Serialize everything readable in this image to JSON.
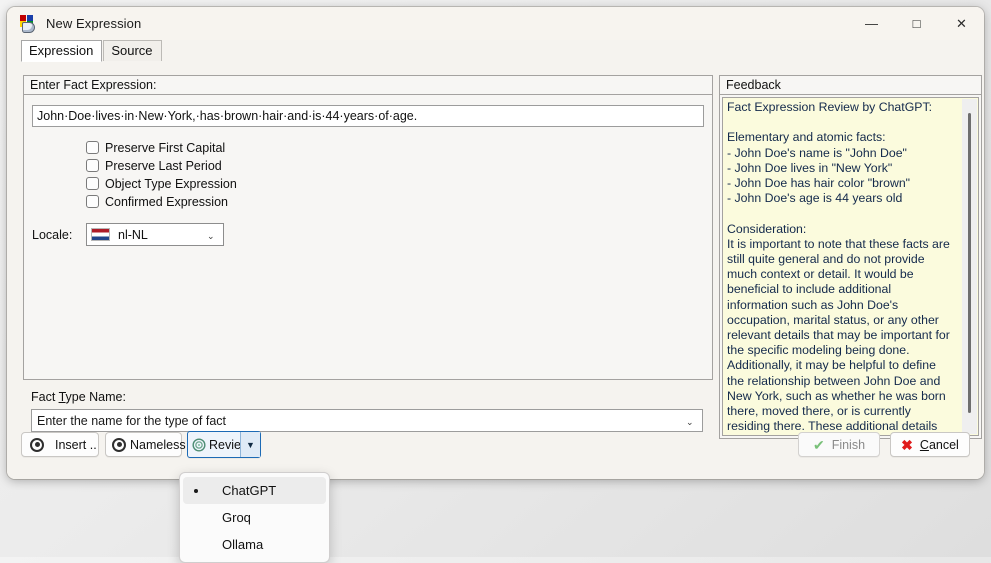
{
  "window": {
    "title": "New Expression",
    "icon": "app-cube-icon",
    "controls": {
      "minimize": "—",
      "maximize": "□",
      "close": "✕"
    }
  },
  "tabs": [
    {
      "label": "Expression",
      "active": true
    },
    {
      "label": "Source",
      "active": false
    }
  ],
  "expression_group": {
    "title": "Enter Fact Expression:",
    "input_value": "John·Doe·lives·in·New·York,·has·brown·hair·and·is·44·years·of·age.",
    "checkboxes": [
      {
        "label": "Preserve First Capital",
        "checked": false
      },
      {
        "label": "Preserve Last Period",
        "checked": false
      },
      {
        "label": "Object Type Expression",
        "checked": false
      },
      {
        "label": "Confirmed Expression",
        "checked": false
      }
    ],
    "locale": {
      "label": "Locale:",
      "value": "nl-NL",
      "flag": "flag-netherlands",
      "arrow": "⌄"
    }
  },
  "fact_type_group": {
    "title_prefix": "Fact ",
    "title_mnemonic": "T",
    "title_suffix": "ype Name:",
    "placeholder": "Enter the name for the type of fact",
    "arrow": "⌄"
  },
  "feedback": {
    "title": "Feedback",
    "text": "Fact Expression Review by ChatGPT:\n\nElementary and atomic facts:\n- John Doe's name is \"John Doe\"\n- John Doe lives in \"New York\"\n- John Doe has hair color \"brown\"\n- John Doe's age is 44 years old\n\nConsideration:\nIt is important to note that these facts are still quite general and do not provide much context or detail. It would be beneficial to include additional information such as John Doe's occupation, marital status, or any other relevant details that may be important for the specific modeling being done. Additionally, it may be helpful to define the relationship between John Doe and New York, such as whether he was born there, moved there, or is currently residing there. These additional details can help to create a more comprehensive and accurate model."
  },
  "buttons": {
    "insert": {
      "label": "Insert ..",
      "icon": "eye-icon"
    },
    "nameless": {
      "label": "Nameless",
      "icon": "eye-icon"
    },
    "review": {
      "label": "Review",
      "icon": "chatgpt-logo-icon",
      "split_arrow": "▼"
    },
    "finish": {
      "label": "Finish",
      "icon": "checkmark-icon",
      "enabled": false
    },
    "cancel": {
      "label_prefix": "",
      "label_mnemonic": "C",
      "label_suffix": "ancel",
      "icon": "red-x-icon"
    }
  },
  "review_menu": {
    "items": [
      {
        "label": "ChatGPT",
        "selected": true
      },
      {
        "label": "Groq",
        "selected": false
      },
      {
        "label": "Ollama",
        "selected": false
      }
    ]
  },
  "colors": {
    "feedback_bg": "#fbfbdd",
    "accent_blue": "#1c6ab5",
    "cancel_red": "#e01b1b",
    "finish_green": "#78c078"
  }
}
